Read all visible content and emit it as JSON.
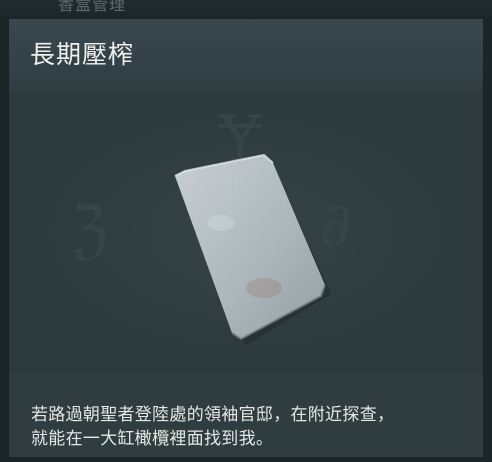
{
  "header_partial": "香盒管理",
  "item": {
    "name": "長期壓榨",
    "image_icon": "stone-slab-icon",
    "description": {
      "line1": "若路過朝聖者登陸處的領袖官邸，在附近探查，",
      "line2": "就能在一大缸橄欖裡面找到我。"
    }
  },
  "colors": {
    "background": "#1c2528",
    "card": "#2e3b3f",
    "title_text": "#f1f1ec",
    "body_text": "#e6e8e4",
    "stone": "#b9c3c8"
  }
}
